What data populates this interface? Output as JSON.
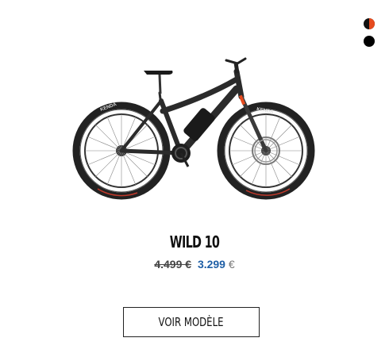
{
  "colors": {
    "accent": "#e64b1e",
    "sale_price": "#1f5fa6",
    "frame": "#2b2b2b"
  },
  "swatches": [
    {
      "name": "black-orange",
      "icon": "half-circle-swatch"
    },
    {
      "name": "black",
      "icon": "solid-circle-swatch"
    }
  ],
  "product": {
    "image_icon": "mountain-ebike-image",
    "tire_brand": "KENDA",
    "name": "WILD 10",
    "old_price": "4.499 €",
    "new_price": "3.299",
    "currency": "€",
    "cta_label": "VOIR MODÈLE"
  }
}
